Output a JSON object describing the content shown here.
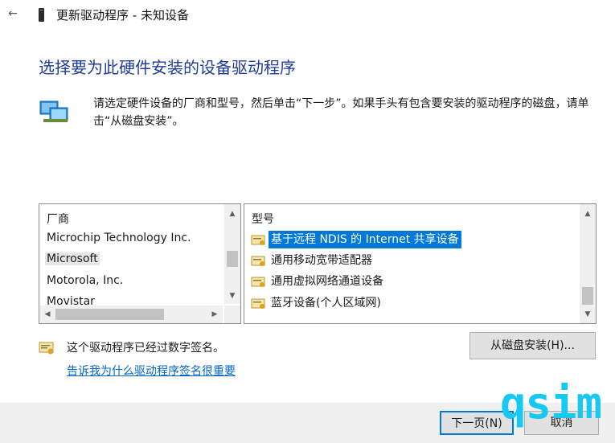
{
  "window": {
    "title": "更新驱动程序 - 未知设备",
    "back_icon": "arrow-left-icon"
  },
  "heading": "选择要为此硬件安装的设备驱动程序",
  "instructions": "请选定硬件设备的厂商和型号，然后单击“下一步”。如果手头有包含要安装的驱动程序的磁盘，请单击“从磁盘安装”。",
  "manufacturer_list": {
    "header": "厂商",
    "items": [
      "Microchip Technology Inc.",
      "Microsoft",
      "Motorola, Inc.",
      "Movistar"
    ],
    "selected": "Microsoft"
  },
  "model_list": {
    "header": "型号",
    "items": [
      "基于远程 NDIS 的 Internet 共享设备",
      "通用移动宽带适配器",
      "通用虚拟网络通道设备",
      "蓝牙设备(个人区域网)"
    ],
    "selected": "基于远程 NDIS 的 Internet 共享设备"
  },
  "signature": {
    "status": "这个驱动程序已经过数字签名。",
    "link": "告诉我为什么驱动程序签名很重要"
  },
  "buttons": {
    "have_disk": "从磁盘安装(H)...",
    "next": "下一页(N)",
    "cancel": "取消"
  },
  "watermark": "qsim",
  "colors": {
    "accent": "#0078d7",
    "heading": "#1f3c9a",
    "link": "#0066cc",
    "watermark": "#17c9f0"
  }
}
